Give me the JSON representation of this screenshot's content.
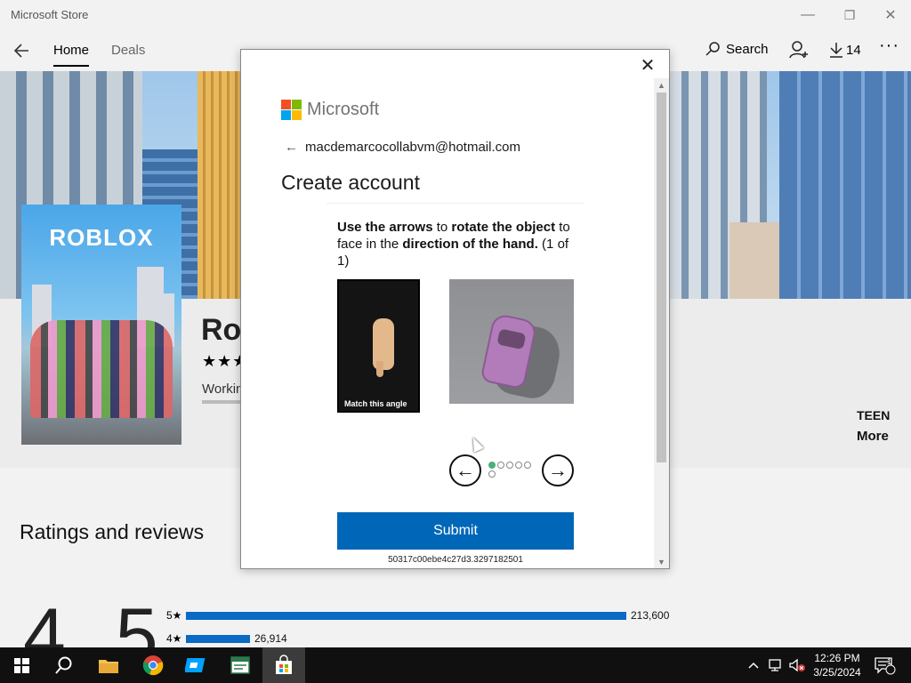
{
  "window": {
    "title": "Microsoft Store",
    "minimize": "—",
    "maximize": "❐",
    "close": "✕"
  },
  "nav": {
    "back": "←",
    "tabs": [
      "Home",
      "Deals"
    ],
    "search_label": "Search",
    "downloads_count": "14",
    "more": "···"
  },
  "product": {
    "tile_logo": "ROBLOX",
    "title_partial": "Rol",
    "stars": "★★★",
    "status_partial": "Workin",
    "age_rating": "TEEN",
    "more_label": "More"
  },
  "ratings": {
    "heading": "Ratings and reviews",
    "average": "4.5",
    "rows": [
      {
        "label": "5★",
        "count": "213,600",
        "fraction": 1.0
      },
      {
        "label": "4★",
        "count": "26,914",
        "fraction": 0.145
      }
    ]
  },
  "dialog": {
    "close": "✕",
    "brand": "Microsoft",
    "back": "←",
    "email": "macdemarcocollabvm@hotmail.com",
    "heading": "Create account",
    "captcha": {
      "instruction_parts": [
        "Use the arrows",
        " to ",
        "rotate the object",
        " to face in the ",
        "direction of the hand.",
        " (1 of 1)"
      ],
      "match_label": "Match this angle",
      "left_arrow": "←",
      "right_arrow": "→",
      "dots_total": 6,
      "dots_active": 1
    },
    "submit_label": "Submit",
    "session_id": "50317c00ebe4c27d3.3297182501"
  },
  "taskbar": {
    "time": "12:26 PM",
    "date": "3/25/2024",
    "notification_count": "1"
  }
}
